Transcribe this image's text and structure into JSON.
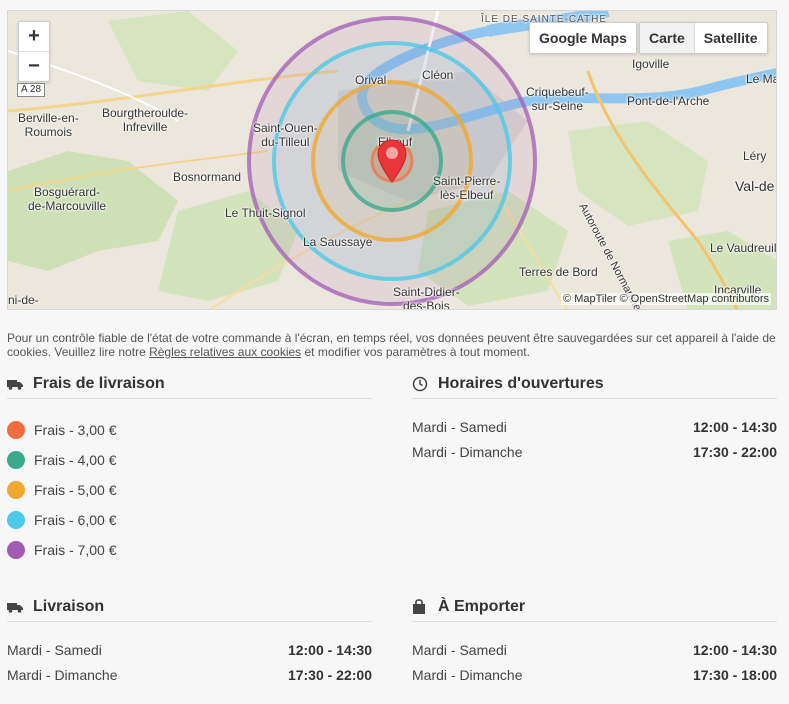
{
  "map": {
    "zoom_in": "+",
    "zoom_out": "−",
    "road_shield": "A 28",
    "google_maps_label": "Google Maps",
    "map_types": [
      "Carte",
      "Satellite"
    ],
    "active_map_type": "Carte",
    "attribution": "© MapTiler © OpenStreetMap contributors",
    "places": [
      {
        "label": "ÎLE DE SAINTE-CATHE"
      },
      {
        "label": "Igoville"
      },
      {
        "label": "Le Manc"
      },
      {
        "label": "Berville-en-\nRoumois"
      },
      {
        "label": "Bourgtheroulde-\nInfreville"
      },
      {
        "label": "Orival"
      },
      {
        "label": "Cléon"
      },
      {
        "label": "Criquebeuf-\nsur-Seine"
      },
      {
        "label": "Pont-de-l'Arche"
      },
      {
        "label": "Saint-Ouen-\ndu-Tilleul"
      },
      {
        "label": "Elbeuf"
      },
      {
        "label": "Léry"
      },
      {
        "label": "Val-de"
      },
      {
        "label": "Bosnormand"
      },
      {
        "label": "Saint-Pierre-\nlès-Elbeuf"
      },
      {
        "label": "Bosguérard-\nde-Marcouville"
      },
      {
        "label": "Le Thuit-Signol"
      },
      {
        "label": "La Saussaye"
      },
      {
        "label": "Le Vaudreuil"
      },
      {
        "label": "Autoroute de Normandie"
      },
      {
        "label": "Terres de Bord"
      },
      {
        "label": "Incarville"
      },
      {
        "label": "Saint-Didier-\ndes-Bois"
      },
      {
        "label": "ni-de-"
      }
    ],
    "zones_colors": [
      "#f26d3d",
      "#3ba98c",
      "#f0a830",
      "#4dc8e6",
      "#a25cb5"
    ],
    "marker_color": "#e8363a"
  },
  "cookies": {
    "text_before": "Pour un contrôle fiable de l'état de votre commande à l'écran, en temps réel, vos données peuvent être sauvegardées sur cet appareil à l'aide de cookies. Veuillez lire notre ",
    "link": "Règles relatives aux cookies",
    "text_after": " et modifier vos paramètres à tout moment."
  },
  "delivery_fees": {
    "title": "Frais de livraison",
    "icon": "truck-icon",
    "items": [
      {
        "label": "Frais - 3,00 €",
        "color": "#f26d3d"
      },
      {
        "label": "Frais - 4,00 €",
        "color": "#3ba98c"
      },
      {
        "label": "Frais - 5,00 €",
        "color": "#f0a830"
      },
      {
        "label": "Frais - 6,00 €",
        "color": "#4dc8e6"
      },
      {
        "label": "Frais - 7,00 €",
        "color": "#a25cb5"
      }
    ]
  },
  "opening_hours": {
    "title": "Horaires d'ouvertures",
    "icon": "clock-icon",
    "rows": [
      {
        "days": "Mardi - Samedi",
        "time": "12:00 - 14:30"
      },
      {
        "days": "Mardi - Dimanche",
        "time": "17:30 - 22:00"
      }
    ]
  },
  "delivery": {
    "title": "Livraison",
    "icon": "truck-icon",
    "rows": [
      {
        "days": "Mardi - Samedi",
        "time": "12:00 - 14:30"
      },
      {
        "days": "Mardi - Dimanche",
        "time": "17:30 - 22:00"
      }
    ]
  },
  "takeaway": {
    "title": "À Emporter",
    "icon": "shopping-bag-icon",
    "rows": [
      {
        "days": "Mardi - Samedi",
        "time": "12:00 - 14:30"
      },
      {
        "days": "Mardi - Dimanche",
        "time": "17:30 - 18:00"
      }
    ]
  }
}
